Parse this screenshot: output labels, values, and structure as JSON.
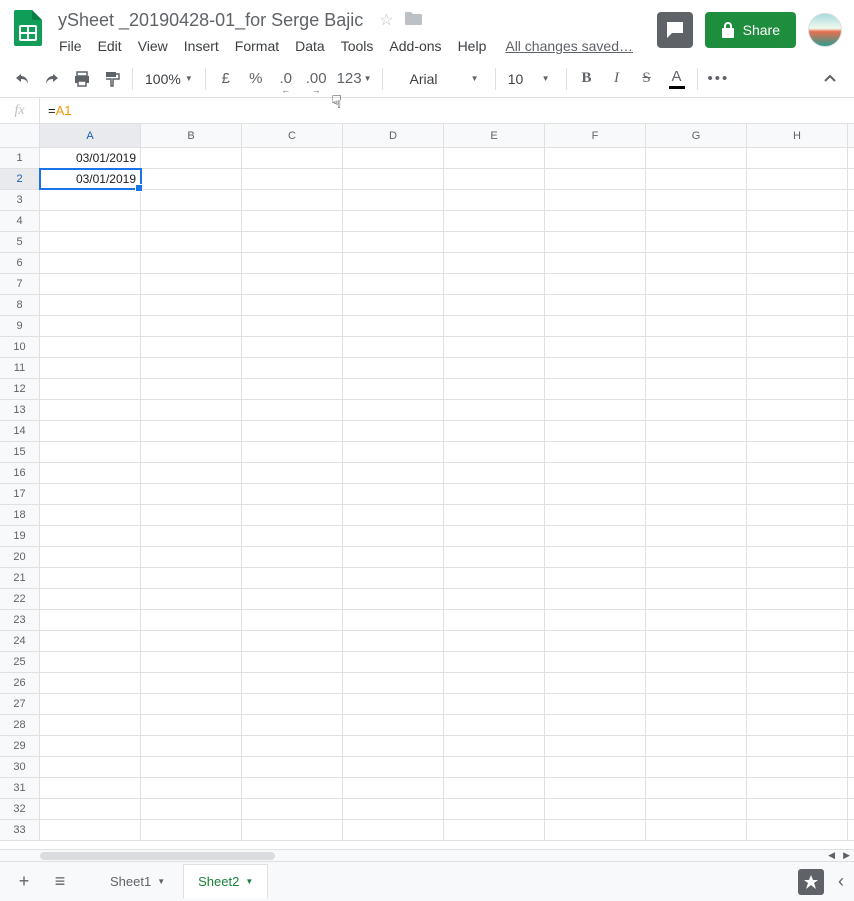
{
  "doc": {
    "title": "ySheet _20190428-01_for Serge Bajic"
  },
  "menus": [
    "File",
    "Edit",
    "View",
    "Insert",
    "Format",
    "Data",
    "Tools",
    "Add-ons",
    "Help"
  ],
  "savedText": "All changes saved…",
  "shareLabel": "Share",
  "toolbar": {
    "zoom": "100%",
    "currency": "£",
    "percent": "%",
    "decDecrease": ".0",
    "decIncrease": ".00",
    "numFormat": "123",
    "font": "Arial",
    "fontSize": "10",
    "bold": "B",
    "italic": "I",
    "strike": "S",
    "textColor": "A",
    "more": "•••"
  },
  "formula": {
    "eq": "=",
    "ref": "A1"
  },
  "columns": [
    "A",
    "B",
    "C",
    "D",
    "E",
    "F",
    "G",
    "H"
  ],
  "rows": 33,
  "cells": {
    "A1": "03/01/2019",
    "A2": "03/01/2019"
  },
  "activeCell": "A2",
  "tabs": [
    {
      "name": "Sheet1",
      "active": false
    },
    {
      "name": "Sheet2",
      "active": true
    }
  ]
}
